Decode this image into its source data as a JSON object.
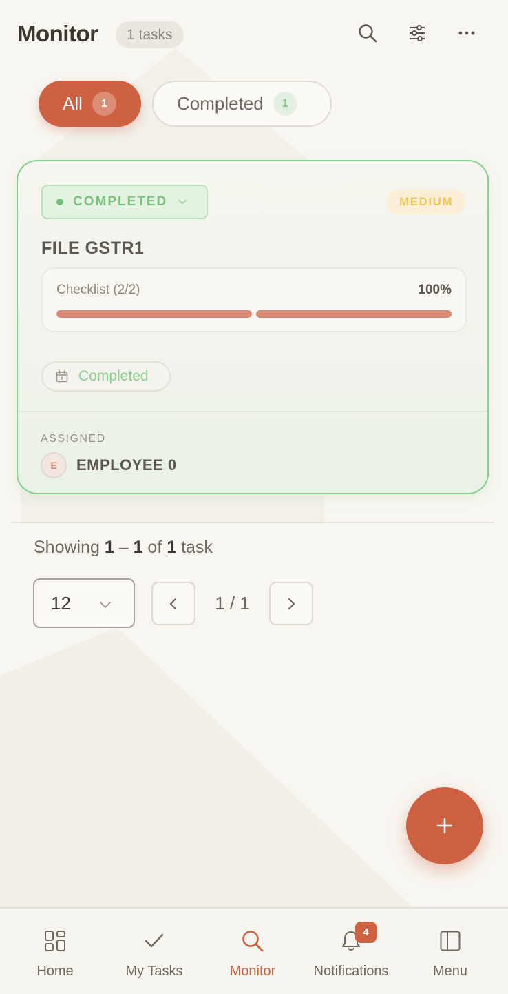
{
  "header": {
    "title": "Monitor",
    "task_count": "1 tasks"
  },
  "filters": [
    {
      "label": "All",
      "count": "1",
      "active": true
    },
    {
      "label": "Completed",
      "count": "1",
      "active": false
    }
  ],
  "task": {
    "status": "COMPLETED",
    "priority": "MEDIUM",
    "title": "FILE GSTR1",
    "checklist_label": "Checklist (2/2)",
    "checklist_percent": "100%",
    "checklist_done": 2,
    "checklist_total": 2,
    "due_label": "Completed",
    "assigned_label": "ASSIGNED",
    "assignee_initial": "E",
    "assignee_name": "EMPLOYEE 0"
  },
  "pagination": {
    "showing_prefix": "Showing ",
    "range_start": "1",
    "range_sep": " – ",
    "range_end": "1",
    "of_text": " of ",
    "total": "1",
    "suffix": " task",
    "page_size": "12",
    "page_indicator": "1 / 1"
  },
  "nav": {
    "items": [
      {
        "label": "Home",
        "icon": "grid-icon"
      },
      {
        "label": "My Tasks",
        "icon": "check-icon"
      },
      {
        "label": "Monitor",
        "icon": "search-icon",
        "active": true
      },
      {
        "label": "Notifications",
        "icon": "bell-icon",
        "badge": "4"
      },
      {
        "label": "Menu",
        "icon": "sidebar-icon"
      }
    ]
  },
  "colors": {
    "accent": "#cd6142",
    "success": "#7bc27f",
    "warning": "#f2c65a",
    "background": "#f8f6f1"
  }
}
